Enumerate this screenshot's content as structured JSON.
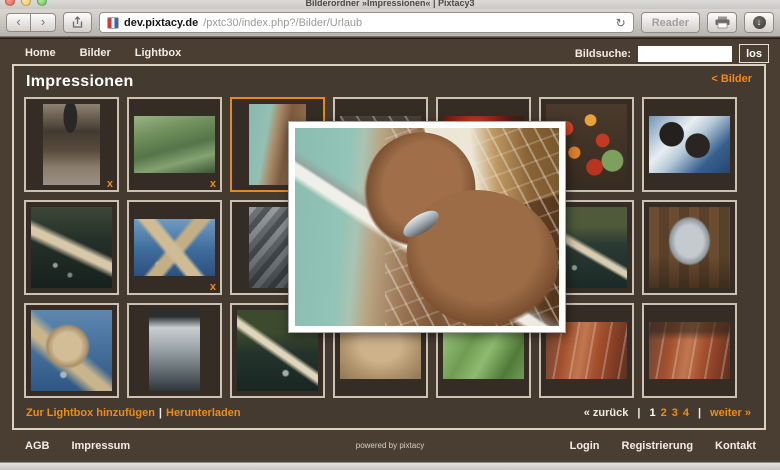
{
  "browser": {
    "title": "Bilderordner »Impressionen« | Pixtacy3",
    "url": {
      "domain": "dev.pixtacy.de",
      "path": "/pxtc30/index.php?/Bilder/Urlaub"
    },
    "reader_label": "Reader",
    "back_glyph": "‹",
    "forward_glyph": "›",
    "reload_glyph": "↻",
    "download_glyph": "↓"
  },
  "nav": {
    "items": [
      "Home",
      "Bilder",
      "Lightbox"
    ],
    "search": {
      "label": "Bildsuche:",
      "value": "",
      "button": "los"
    }
  },
  "gallery": {
    "title": "Impressionen",
    "back_link": "< Bilder",
    "remove_marker": "x",
    "thumbnails": [
      {
        "id": "fisherman-with-catch",
        "orientation": "portrait",
        "selected": false,
        "removable": true
      },
      {
        "id": "green-net",
        "orientation": "landscape",
        "selected": false,
        "removable": true
      },
      {
        "id": "hands-holding-fish",
        "orientation": "portrait",
        "selected": true,
        "removable": false
      },
      {
        "id": "boat-rigging",
        "orientation": "landscape",
        "selected": false,
        "removable": false
      },
      {
        "id": "red-flower",
        "orientation": "landscape",
        "selected": false,
        "removable": false
      },
      {
        "id": "flower-berries",
        "orientation": "full",
        "selected": false,
        "removable": false
      },
      {
        "id": "sunglasses-sea",
        "orientation": "landscape",
        "selected": false,
        "removable": false
      },
      {
        "id": "rope-over-water",
        "orientation": "full",
        "selected": false,
        "removable": false
      },
      {
        "id": "rope-knot-sea",
        "orientation": "landscape",
        "selected": false,
        "removable": true
      },
      {
        "id": "silver-fish-pile",
        "orientation": "portrait",
        "selected": false,
        "removable": false
      },
      {
        "id": "covered-1",
        "orientation": "full",
        "selected": false,
        "removable": false
      },
      {
        "id": "covered-2",
        "orientation": "full",
        "selected": false,
        "removable": false
      },
      {
        "id": "rope-sea-trees",
        "orientation": "full",
        "selected": false,
        "removable": false
      },
      {
        "id": "fish-bowl-deck",
        "orientation": "full",
        "selected": false,
        "removable": false
      },
      {
        "id": "rope-knot-closeup",
        "orientation": "full",
        "selected": false,
        "removable": false
      },
      {
        "id": "fish-heads",
        "orientation": "narrow",
        "selected": false,
        "removable": false
      },
      {
        "id": "rope-water-forest",
        "orientation": "full",
        "selected": false,
        "removable": false
      },
      {
        "id": "sand-texture",
        "orientation": "landscape",
        "selected": false,
        "removable": false
      },
      {
        "id": "green-rope-closeup",
        "orientation": "landscape",
        "selected": false,
        "removable": false
      },
      {
        "id": "red-deck-1",
        "orientation": "landscape",
        "selected": false,
        "removable": false
      },
      {
        "id": "red-deck-2",
        "orientation": "landscape",
        "selected": false,
        "removable": false
      }
    ],
    "actions": {
      "add_to_lightbox": "Zur Lightbox hinzufügen",
      "separator": "|",
      "download": "Herunterladen"
    },
    "pagination": {
      "prev": "« zurück",
      "separator": "|",
      "pages": [
        "1",
        "2",
        "3",
        "4"
      ],
      "current_page": "1",
      "next": "weiter »"
    }
  },
  "footer": {
    "left": [
      "AGB",
      "Impressum"
    ],
    "center": "powered by pixtacy",
    "right": [
      "Login",
      "Registrierung",
      "Kontakt"
    ]
  },
  "colors": {
    "accent": "#ee8c19",
    "page_bg": "#4a3e33",
    "panel_border": "#dbd0c1",
    "cell_border": "#cdc2b2",
    "cell_bg": "#352d25",
    "selected_border": "#e8891b"
  }
}
